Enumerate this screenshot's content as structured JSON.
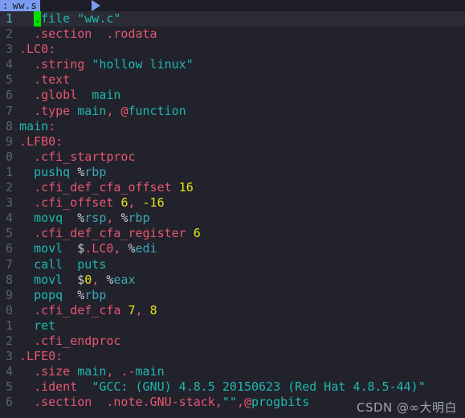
{
  "window": {
    "background_color": "#21222c",
    "tab_color": "#7a9bf0"
  },
  "tabbar": {
    "prefix": ":",
    "tab_label": "ww.s"
  },
  "editor": {
    "cursor_char": ".",
    "cursor_color": "#00e000",
    "current_line": 1,
    "line_numbers_truncated": true,
    "gutter_numbers": [
      "1",
      "2",
      "3",
      "4",
      "5",
      "6",
      "7",
      "8",
      "9",
      "0",
      "1",
      "2",
      "3",
      "4",
      "5",
      "6",
      "7",
      "8",
      "9",
      "0",
      "1",
      "2",
      "3",
      "4",
      "5",
      "6"
    ],
    "lines": [
      {
        "n": "1",
        "text": "  .file \"ww.c\""
      },
      {
        "n": "2",
        "text": "  .section  .rodata"
      },
      {
        "n": "3",
        "text": ".LC0:"
      },
      {
        "n": "4",
        "text": "  .string \"hollow linux\""
      },
      {
        "n": "5",
        "text": "  .text"
      },
      {
        "n": "6",
        "text": "  .globl  main"
      },
      {
        "n": "7",
        "text": "  .type main, @function"
      },
      {
        "n": "8",
        "text": "main:"
      },
      {
        "n": "9",
        "text": ".LFB0:"
      },
      {
        "n": "0",
        "text": "  .cfi_startproc"
      },
      {
        "n": "1",
        "text": "  pushq %rbp"
      },
      {
        "n": "2",
        "text": "  .cfi_def_cfa_offset 16"
      },
      {
        "n": "3",
        "text": "  .cfi_offset 6, -16"
      },
      {
        "n": "4",
        "text": "  movq  %rsp, %rbp"
      },
      {
        "n": "5",
        "text": "  .cfi_def_cfa_register 6"
      },
      {
        "n": "6",
        "text": "  movl  $.LC0, %edi"
      },
      {
        "n": "7",
        "text": "  call  puts"
      },
      {
        "n": "8",
        "text": "  movl  $0, %eax"
      },
      {
        "n": "9",
        "text": "  popq  %rbp"
      },
      {
        "n": "0",
        "text": "  .cfi_def_cfa 7, 8"
      },
      {
        "n": "1",
        "text": "  ret"
      },
      {
        "n": "2",
        "text": "  .cfi_endproc"
      },
      {
        "n": "3",
        "text": ".LFE0:"
      },
      {
        "n": "4",
        "text": "  .size main, .-main"
      },
      {
        "n": "5",
        "text": "  .ident  \"GCC: (GNU) 4.8.5 20150623 (Red Hat 4.8.5-44)\""
      },
      {
        "n": "6",
        "text": "  .section  .note.GNU-stack,\"\",@progbits"
      }
    ]
  },
  "watermark": {
    "text": "CSDN @∞大明白"
  }
}
